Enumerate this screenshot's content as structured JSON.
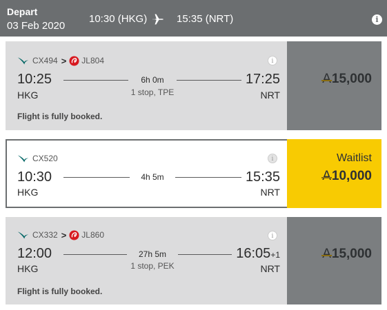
{
  "header": {
    "depart_label": "Depart",
    "date": "03 Feb 2020",
    "depart_time": "10:30 (HKG)",
    "arrive_time": "15:35 (NRT)",
    "info_icon": "info-icon"
  },
  "flights": [
    {
      "segments": [
        "CX494",
        "JL804"
      ],
      "dep_time": "10:25",
      "dep_code": "HKG",
      "arr_time": "17:25",
      "arr_code": "NRT",
      "duration": "6h 0m",
      "stops": "1 stop, TPE",
      "note": "Flight is fully booked.",
      "status": "",
      "miles": "15,000",
      "state": "booked"
    },
    {
      "segments": [
        "CX520"
      ],
      "dep_time": "10:30",
      "dep_code": "HKG",
      "arr_time": "15:35",
      "arr_code": "NRT",
      "duration": "4h 5m",
      "stops": "",
      "note": "",
      "status": "Waitlist",
      "miles": "10,000",
      "state": "selected"
    },
    {
      "segments": [
        "CX332",
        "JL860"
      ],
      "dep_time": "12:00",
      "dep_code": "HKG",
      "arr_time": "16:05",
      "arr_day_offset": "+1",
      "arr_code": "NRT",
      "duration": "27h 5m",
      "stops": "1 stop, PEK",
      "note": "Flight is fully booked.",
      "status": "",
      "miles": "15,000",
      "state": "booked"
    }
  ],
  "icons": {
    "currency": "asia-miles-icon",
    "airline_cx": "cathay-pacific-logo",
    "airline_jl": "japan-airlines-logo",
    "connection": "chevron-right-icon"
  },
  "colors": {
    "header_bg": "#6b6e70",
    "booked_card_bg": "#dcdcdd",
    "booked_fare_bg": "#7b7e80",
    "selected_fare_bg": "#f8cb02",
    "cx_green": "#006564",
    "jl_red": "#d71920"
  }
}
